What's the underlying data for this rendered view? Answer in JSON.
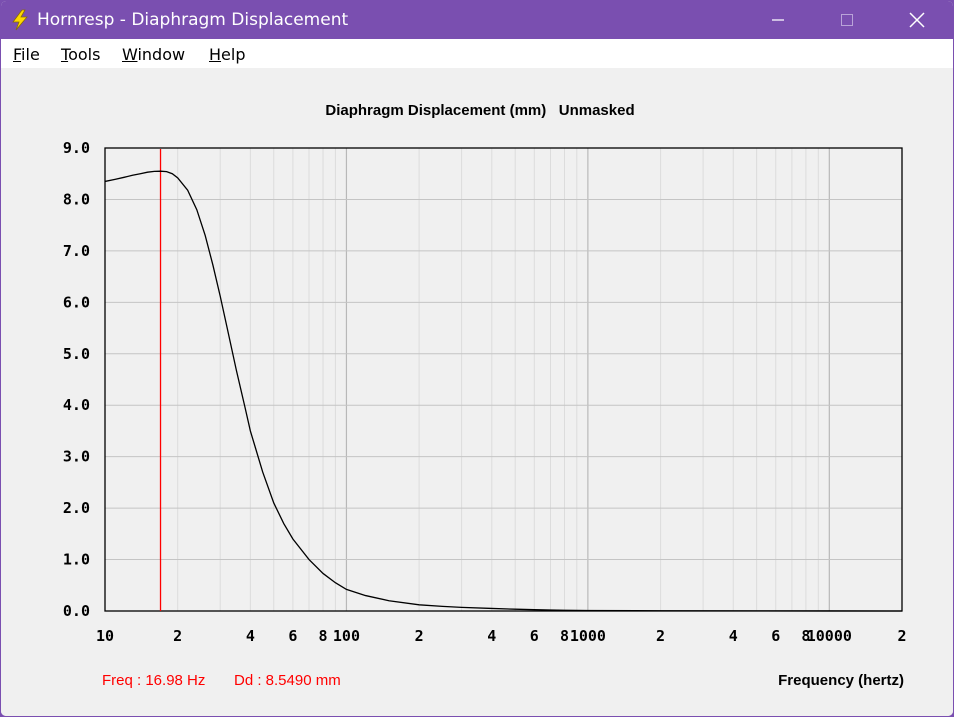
{
  "window": {
    "title": "Hornresp - Diaphragm Displacement",
    "icon": "lightning-bolt-icon",
    "accent_color": "#7a4fb0"
  },
  "menu": {
    "items": [
      {
        "label_first": "F",
        "label_rest": "ile"
      },
      {
        "label_first": "T",
        "label_rest": "ools"
      },
      {
        "label_first": "W",
        "label_rest": "indow"
      },
      {
        "label_first": "H",
        "label_rest": "elp"
      }
    ]
  },
  "cursor_readout": {
    "freq_text": "Freq : 16.98 Hz",
    "dd_text": "Dd : 8.5490 mm",
    "color": "#ff0000"
  },
  "chart_data": {
    "type": "line",
    "title": "Diaphragm Displacement (mm)   Unmasked",
    "xlabel": "Frequency (hertz)",
    "ylabel": "",
    "x_scale": "log",
    "xlim": [
      10,
      20000
    ],
    "ylim": [
      0,
      9
    ],
    "grid": true,
    "y_ticks": [
      "0.0",
      "1.0",
      "2.0",
      "3.0",
      "4.0",
      "5.0",
      "6.0",
      "7.0",
      "8.0",
      "9.0"
    ],
    "x_tick_labels": [
      {
        "value": 10,
        "label": "10"
      },
      {
        "value": 20,
        "label": "2"
      },
      {
        "value": 40,
        "label": "4"
      },
      {
        "value": 60,
        "label": "6"
      },
      {
        "value": 80,
        "label": "8"
      },
      {
        "value": 100,
        "label": "100"
      },
      {
        "value": 200,
        "label": "2"
      },
      {
        "value": 400,
        "label": "4"
      },
      {
        "value": 600,
        "label": "6"
      },
      {
        "value": 800,
        "label": "8"
      },
      {
        "value": 1000,
        "label": "1000"
      },
      {
        "value": 2000,
        "label": "2"
      },
      {
        "value": 4000,
        "label": "4"
      },
      {
        "value": 6000,
        "label": "6"
      },
      {
        "value": 8000,
        "label": "8"
      },
      {
        "value": 10000,
        "label": "10000"
      },
      {
        "value": 20000,
        "label": "2"
      }
    ],
    "marker_frequency": 16.98,
    "marker_color": "#ff0000",
    "line_color": "#000000",
    "series": [
      {
        "x": [
          10,
          11,
          12,
          13,
          14,
          15,
          16,
          16.98,
          18,
          19,
          20,
          22,
          24,
          26,
          28,
          30,
          32,
          35,
          38,
          40,
          45,
          50,
          55,
          60,
          70,
          80,
          90,
          100,
          120,
          150,
          200,
          250,
          300,
          400,
          500,
          600,
          700,
          800,
          1000,
          2000,
          5000,
          10000,
          20000
        ],
        "y": [
          8.35,
          8.39,
          8.43,
          8.47,
          8.5,
          8.53,
          8.545,
          8.549,
          8.54,
          8.5,
          8.42,
          8.18,
          7.8,
          7.3,
          6.72,
          6.12,
          5.52,
          4.68,
          3.96,
          3.5,
          2.7,
          2.1,
          1.7,
          1.4,
          1.0,
          0.73,
          0.55,
          0.42,
          0.3,
          0.2,
          0.12,
          0.09,
          0.07,
          0.05,
          0.035,
          0.025,
          0.02,
          0.015,
          0.01,
          0.005,
          0.002,
          0.001,
          0.0
        ]
      }
    ]
  }
}
